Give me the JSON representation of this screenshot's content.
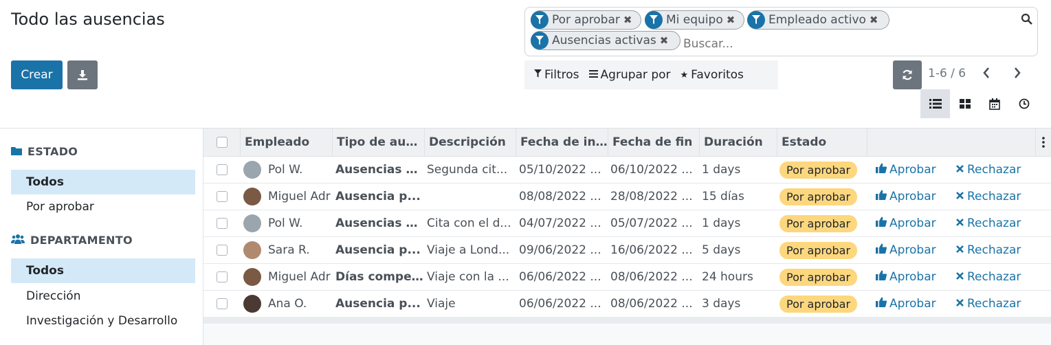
{
  "page": {
    "title": "Todo las ausencias"
  },
  "toolbar": {
    "create_label": "Crear",
    "download_icon": "download-icon"
  },
  "search": {
    "facets": [
      "Por aprobar",
      "Mi equipo",
      "Empleado activo",
      "Ausencias activas"
    ],
    "placeholder": "Buscar..."
  },
  "filters": {
    "filters_label": "Filtros",
    "group_label": "Agrupar por",
    "favorites_label": "Favoritos"
  },
  "pager": {
    "value": "1-6 / 6"
  },
  "sidebar": {
    "estado": {
      "title": "ESTADO",
      "items": [
        "Todos",
        "Por aprobar"
      ]
    },
    "departamento": {
      "title": "DEPARTAMENTO",
      "items": [
        "Todos",
        "Dirección",
        "Investigación y Desarrollo"
      ]
    }
  },
  "table": {
    "columns": [
      "Empleado",
      "Tipo de ausencia",
      "Descripción",
      "Fecha de inicio",
      "Fecha de fin",
      "Duración",
      "Estado"
    ],
    "approve_label": "Aprobar",
    "reject_label": "Rechazar",
    "rows": [
      {
        "empleado": "Pol W.",
        "tipo": "Ausencias p...",
        "descripcion": "Segunda cit...",
        "inicio": "05/10/2022 ...",
        "fin": "06/10/2022 ...",
        "duracion": "1 days",
        "estado": "Por aprobar"
      },
      {
        "empleado": "Miguel Adr",
        "tipo": "Ausencia p...",
        "descripcion": "",
        "inicio": "08/08/2022 ...",
        "fin": "28/08/2022 ...",
        "duracion": "15 días",
        "estado": "Por aprobar"
      },
      {
        "empleado": "Pol W.",
        "tipo": "Ausencias p...",
        "descripcion": "Cita con el d...",
        "inicio": "04/07/2022 ...",
        "fin": "05/07/2022 ...",
        "duracion": "1 days",
        "estado": "Por aprobar"
      },
      {
        "empleado": "Sara R.",
        "tipo": "Ausencia p...",
        "descripcion": "Viaje a Lond...",
        "inicio": "09/06/2022 ...",
        "fin": "16/06/2022 ...",
        "duracion": "5 days",
        "estado": "Por aprobar"
      },
      {
        "empleado": "Miguel Adr",
        "tipo": "Días compe...",
        "descripcion": "Viaje con la ...",
        "inicio": "06/06/2022 ...",
        "fin": "08/06/2022 ...",
        "duracion": "24 hours",
        "estado": "Por aprobar"
      },
      {
        "empleado": "Ana O.",
        "tipo": "Ausencia p...",
        "descripcion": "Viaje",
        "inicio": "06/06/2022 ...",
        "fin": "08/06/2022 ...",
        "duracion": "3 days",
        "estado": "Por aprobar"
      }
    ]
  },
  "colors": {
    "primary": "#1a73a8",
    "badge": "#fcd77e",
    "active_sidebar": "#d4e9f7",
    "secondary": "#6c757d"
  }
}
